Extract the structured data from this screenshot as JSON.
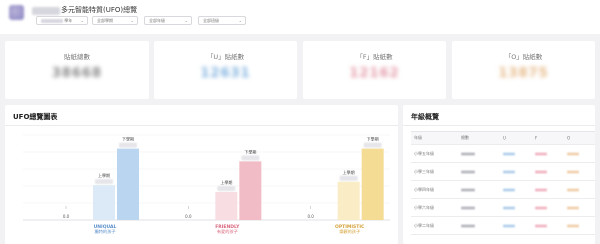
{
  "header": {
    "title": "多元智能特質(UFO)總覽",
    "filters": [
      {
        "label": "學年",
        "blurred": true
      },
      {
        "label": "全部學期",
        "blurred": false
      },
      {
        "label": "全部年級",
        "blurred": false
      },
      {
        "label": "全部班級",
        "blurred": false
      }
    ]
  },
  "stats": [
    {
      "label": "貼紙總數",
      "value": "38668",
      "color": "#888888"
    },
    {
      "label": "「U」貼紙數",
      "value": "12631",
      "color": "#7fb1de"
    },
    {
      "label": "「F」貼紙數",
      "value": "12162",
      "color": "#e39aa8"
    },
    {
      "label": "「O」貼紙數",
      "value": "13875",
      "color": "#e6b987"
    }
  ],
  "ufo_panel": {
    "title": "UFO總覽圖表"
  },
  "grade_panel": {
    "title": "年級概覽",
    "columns": [
      "年級",
      "總數",
      "U",
      "F",
      "O"
    ],
    "rows": [
      {
        "grade": "小學五年級"
      },
      {
        "grade": "小學三年級"
      },
      {
        "grade": "小學四年級"
      },
      {
        "grade": "小學六年級"
      },
      {
        "grade": "小學二年級"
      }
    ]
  },
  "chart_data": {
    "type": "bar",
    "categories": [
      {
        "en": "UNIQUAL",
        "zh": "獨特的孩子",
        "color": "#5b8fc9"
      },
      {
        "en": "FRIENDLY",
        "zh": "有愛的孩子",
        "color": "#d9667d"
      },
      {
        "en": "OPTIMISTIC",
        "zh": "樂觀的孩子",
        "color": "#d4a23a"
      }
    ],
    "series": [
      {
        "name": "",
        "values": [
          0,
          0,
          0
        ]
      },
      {
        "name": "上學期",
        "values": [
          41,
          33,
          45
        ]
      },
      {
        "name": "下學期",
        "values": [
          84,
          69,
          84
        ]
      }
    ],
    "zero_label": "0.0",
    "series_colors": [
      [
        "#cfe1f3",
        "#dce9f6",
        "#b9d5ef"
      ],
      [
        "#f6cfd6",
        "#f8dde2",
        "#f1bcc6"
      ],
      [
        "#f8e6b2",
        "#faecc4",
        "#f5dc95"
      ]
    ],
    "ylim": [
      0,
      100
    ]
  }
}
